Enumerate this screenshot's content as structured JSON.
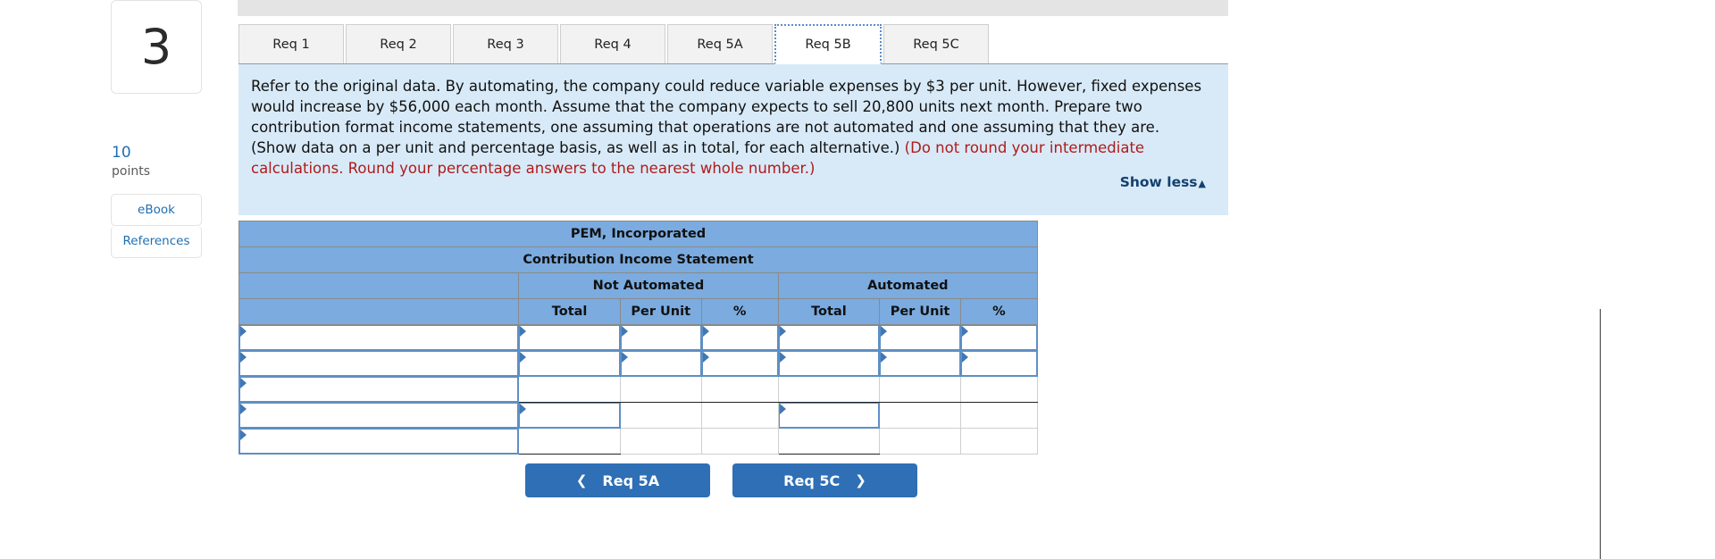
{
  "question": {
    "number": "3",
    "points_value": "10",
    "points_label": "points"
  },
  "rail": {
    "ebook_label": "eBook",
    "references_label": "References"
  },
  "tabs": [
    {
      "label": "Req 1",
      "active": false
    },
    {
      "label": "Req 2",
      "active": false
    },
    {
      "label": "Req 3",
      "active": false
    },
    {
      "label": "Req 4",
      "active": false
    },
    {
      "label": "Req 5A",
      "active": false
    },
    {
      "label": "Req 5B",
      "active": true
    },
    {
      "label": "Req 5C",
      "active": false
    }
  ],
  "prompt": {
    "body_part1": "Refer to the original data. By automating, the company could reduce variable expenses by $3 per unit. However, fixed expenses would increase by $56,000 each month. Assume that the company expects to sell 20,800 units next month. Prepare two contribution format income statements, one assuming that operations are not automated and one assuming that they are. (Show data on a per unit and percentage basis, as well as in total, for each alternative.) ",
    "body_red": "(Do not round your intermediate calculations. Round your percentage answers to the nearest whole number.)",
    "show_less_label": "Show less",
    "show_less_caret": "▲"
  },
  "sheet": {
    "company_title": "PEM, Incorporated",
    "statement_title": "Contribution Income Statement",
    "group_headers": [
      "",
      "Not Automated",
      "Automated"
    ],
    "column_headers": [
      "",
      "Total",
      "Per Unit",
      "%",
      "Total",
      "Per Unit",
      "%"
    ],
    "rows": [
      {
        "label": "",
        "cells": [
          "",
          "",
          "",
          "",
          "",
          ""
        ]
      },
      {
        "label": "",
        "cells": [
          "",
          "",
          "",
          "",
          "",
          ""
        ]
      },
      {
        "label": "",
        "cells": [
          "",
          "",
          "",
          "",
          "",
          ""
        ]
      },
      {
        "label": "",
        "cells": [
          "",
          "",
          "",
          "",
          "",
          ""
        ]
      },
      {
        "label": "",
        "cells": [
          "",
          "",
          "",
          "",
          "",
          ""
        ]
      }
    ]
  },
  "nav": {
    "prev_label": "Req 5A",
    "prev_icon": "chevron-left",
    "next_label": "Req 5C",
    "next_icon": "chevron-right"
  },
  "colors": {
    "header_blue": "#7babdf",
    "prompt_blue": "#d8eaf8",
    "accent_blue": "#2e6fb5",
    "link_blue": "#1f6fb2",
    "alert_red": "#b01b1b"
  }
}
